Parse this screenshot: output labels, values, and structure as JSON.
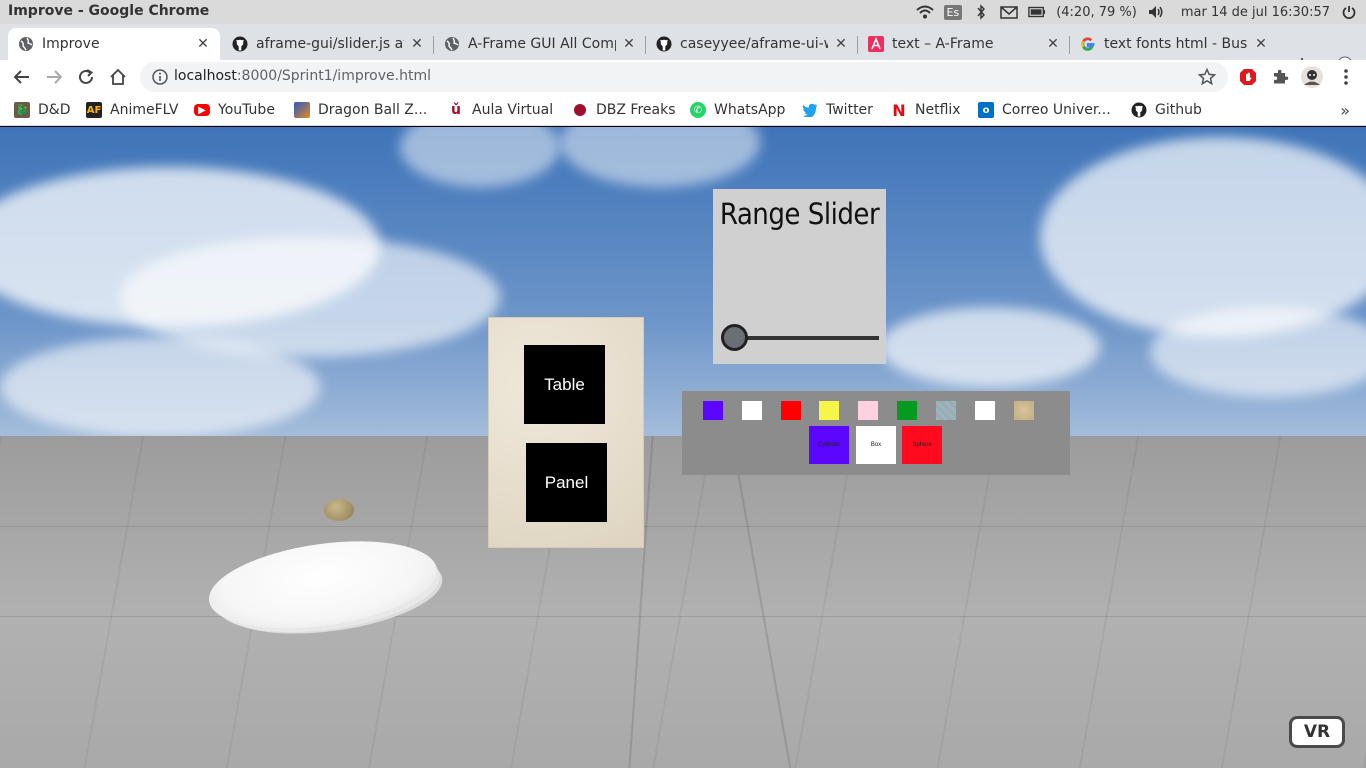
{
  "os": {
    "window_title": "Improve - Google Chrome",
    "lang": "Es",
    "battery": "(4:20, 79 %)",
    "datetime": "mar 14 de jul 16:30:57"
  },
  "tabs": [
    {
      "label": "Improve",
      "icon": "globe-icon",
      "active": true
    },
    {
      "label": "aframe-gui/slider.js at",
      "icon": "github-icon",
      "active": false
    },
    {
      "label": "A-Frame GUI All Comp",
      "icon": "globe-icon",
      "active": false
    },
    {
      "label": "caseyyee/aframe-ui-w",
      "icon": "github-icon",
      "active": false
    },
    {
      "label": "text – A-Frame",
      "icon": "aframe-icon",
      "active": false
    },
    {
      "label": "text fonts html - Busc",
      "icon": "google-icon",
      "active": false
    }
  ],
  "newtab_label": "+",
  "toolbar": {
    "url_host": "localhost",
    "url_path": ":8000/Sprint1/improve.html"
  },
  "bookmarks": [
    {
      "label": "D&D",
      "icon": "dnd-icon"
    },
    {
      "label": "AnimeFLV",
      "icon": "animeflv-icon"
    },
    {
      "label": "YouTube",
      "icon": "youtube-icon"
    },
    {
      "label": "Dragon Ball Z...",
      "icon": "dbz-icon"
    },
    {
      "label": "Aula Virtual",
      "icon": "aula-icon"
    },
    {
      "label": "DBZ Freaks",
      "icon": "dbzfreaks-icon"
    },
    {
      "label": "WhatsApp",
      "icon": "whatsapp-icon"
    },
    {
      "label": "Twitter",
      "icon": "twitter-icon"
    },
    {
      "label": "Netflix",
      "icon": "netflix-icon"
    },
    {
      "label": "Correo Univer...",
      "icon": "outlook-icon"
    },
    {
      "label": "Github",
      "icon": "github-icon"
    }
  ],
  "bookmarks_more": "»",
  "scene": {
    "menu_buttons": [
      "Table",
      "Panel"
    ],
    "slider": {
      "title": "Range Slider",
      "value": 0
    },
    "palette": {
      "swatches": [
        "#5b06ff",
        "#ffffff",
        "#ff0000",
        "#f5f54a",
        "#ffd1e0",
        "#069a20",
        "pattern",
        "#ffffff",
        "texture"
      ],
      "options": [
        {
          "label": "Cylinder",
          "color": "#5b06ff"
        },
        {
          "label": "Box",
          "color": "#ffffff"
        },
        {
          "label": "Sphere",
          "color": "#ff0a1e"
        }
      ]
    },
    "vr_label": "VR"
  }
}
